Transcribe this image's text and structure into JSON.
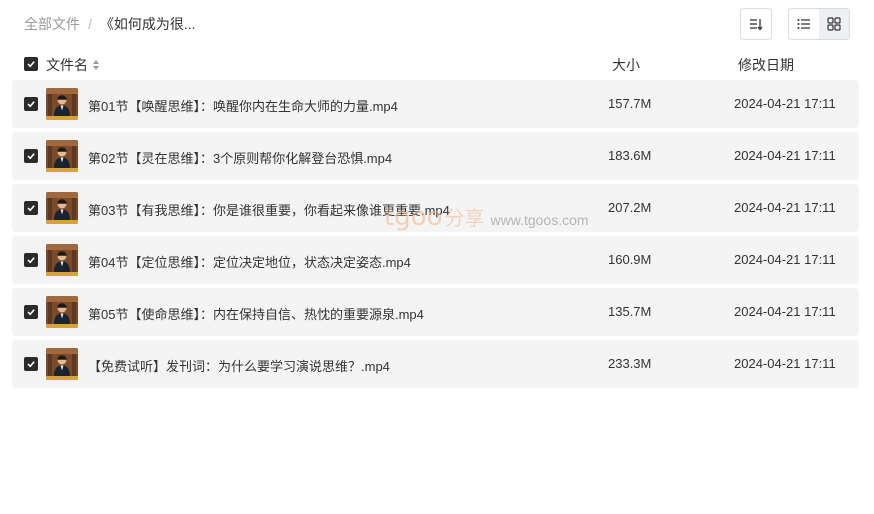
{
  "breadcrumb": {
    "root": "全部文件",
    "separator": "/",
    "current": "《如何成为很..."
  },
  "toolbar": {
    "sort_icon": "sort-icon",
    "list_view_icon": "list-view-icon",
    "grid_view_icon": "grid-view-icon",
    "active_view": "list"
  },
  "columns": {
    "name": "文件名",
    "size": "大小",
    "date": "修改日期"
  },
  "files": [
    {
      "name": "第01节【唤醒思维】：唤醒你内在生命大师的力量.mp4",
      "size": "157.7M",
      "date": "2024-04-21 17:11"
    },
    {
      "name": "第02节【灵在思维】：3个原则帮你化解登台恐惧.mp4",
      "size": "183.6M",
      "date": "2024-04-21 17:11"
    },
    {
      "name": "第03节【有我思维】：你是谁很重要，你看起来像谁更重要.mp4",
      "size": "207.2M",
      "date": "2024-04-21 17:11"
    },
    {
      "name": "第04节【定位思维】：定位决定地位，状态决定姿态.mp4",
      "size": "160.9M",
      "date": "2024-04-21 17:11"
    },
    {
      "name": "第05节【使命思维】：内在保持自信、热忱的重要源泉.mp4",
      "size": "135.7M",
      "date": "2024-04-21 17:11"
    },
    {
      "name": "【免费试听】发刊词：为什么要学习演说思维？.mp4",
      "size": "233.3M",
      "date": "2024-04-21 17:11"
    }
  ],
  "watermark": {
    "logo": "tgoo",
    "cn": "分享",
    "url": "www.tgoos.com"
  },
  "colors": {
    "row_bg": "#f4f4f5",
    "checkbox": "#2b2b2b",
    "watermark": "#f0b48a"
  }
}
